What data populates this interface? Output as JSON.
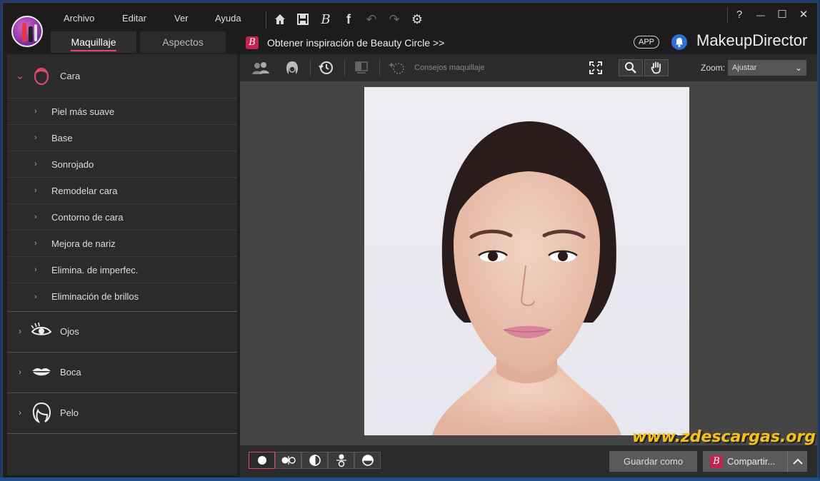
{
  "menu": [
    "Archivo",
    "Editar",
    "Ver",
    "Ayuda"
  ],
  "toolbar_icons": [
    "home-icon",
    "save-icon",
    "beauty-circle-icon",
    "facebook-icon",
    "undo-icon",
    "redo-icon",
    "settings-icon"
  ],
  "tabs": {
    "makeup": "Maquillaje",
    "looks": "Aspectos"
  },
  "beauty_circle": {
    "badge": "B",
    "text": "Obtener inspiración de Beauty Circle >>"
  },
  "app_badge": "APP",
  "brand": "MakeupDirector",
  "window_controls": {
    "help": "?",
    "minimize": "—",
    "maximize": "☐",
    "close": "✕"
  },
  "sidebar": {
    "face": {
      "label": "Cara",
      "items": [
        "Piel más suave",
        "Base",
        "Sonrojado",
        "Remodelar cara",
        "Contorno de cara",
        "Mejora de nariz",
        "Elimina. de imperfec.",
        "Eliminación de brillos"
      ]
    },
    "eyes": "Ojos",
    "mouth": "Boca",
    "hair": "Pelo"
  },
  "workspace_toolbar": {
    "tips_label": "Consejos maquillaje",
    "zoom_label": "Zoom:",
    "zoom_value": "Ajustar"
  },
  "bottom": {
    "save_as": "Guardar como",
    "share": "Compartir..."
  },
  "watermark": "www.zdescargas.org",
  "colors": {
    "accent": "#e0466a",
    "brand_badge": "#c0244f",
    "notify": "#2f6fd6",
    "watermark": "#f2c21a"
  }
}
